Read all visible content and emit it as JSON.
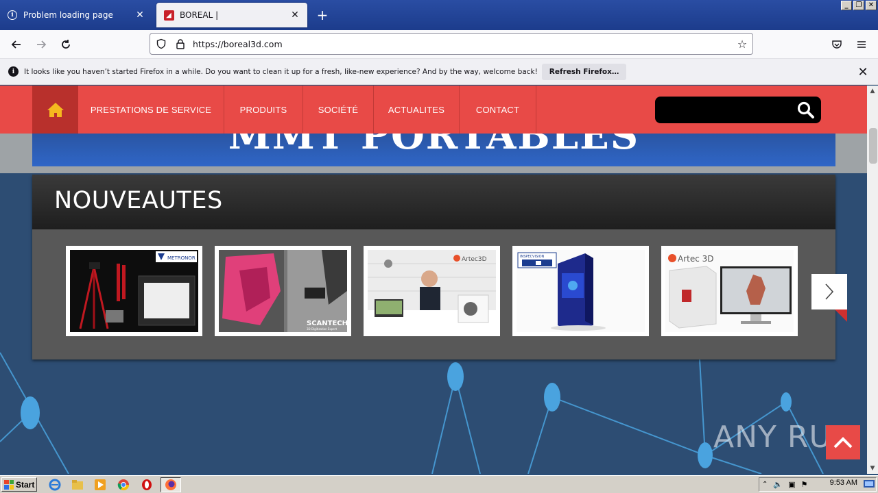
{
  "browser": {
    "tabs": [
      {
        "title": "Problem loading page",
        "icon": "info-icon",
        "active": false
      },
      {
        "title": "BOREAL |",
        "icon": "boreal-favicon-icon",
        "active": true
      }
    ],
    "url": "https://boreal3d.com",
    "notification": {
      "text": "It looks like you haven’t started Firefox in a while. Do you want to clean it up for a fresh, like-new experience? And by the way, welcome back!",
      "button": "Refresh Firefox…"
    }
  },
  "site": {
    "menu": [
      {
        "label": "PRESTATIONS DE SERVICE"
      },
      {
        "label": "PRODUITS"
      },
      {
        "label": "SOCIÉTÉ"
      },
      {
        "label": "ACTUALITES"
      },
      {
        "label": "CONTACT"
      }
    ],
    "banner_text": "MMT PORTABLES",
    "section_title": "NOUVEAUTES",
    "thumbnails": [
      {
        "brand": "METRONOR",
        "subject": "tripod-and-case"
      },
      {
        "brand": "SCANTECH",
        "tagline": "3D Digitization Expert",
        "subject": "car-scanning"
      },
      {
        "brand": "Artec3D",
        "subject": "man-with-scanner"
      },
      {
        "brand": "INSPECVISION",
        "subject": "blue-cabinet"
      },
      {
        "brand": "Artec 3D",
        "subject": "software-box-monitor"
      }
    ],
    "accent_color": "#e84a47"
  },
  "watermark": "ANY RUN",
  "taskbar": {
    "start": "Start",
    "clock": "9:53 AM"
  }
}
